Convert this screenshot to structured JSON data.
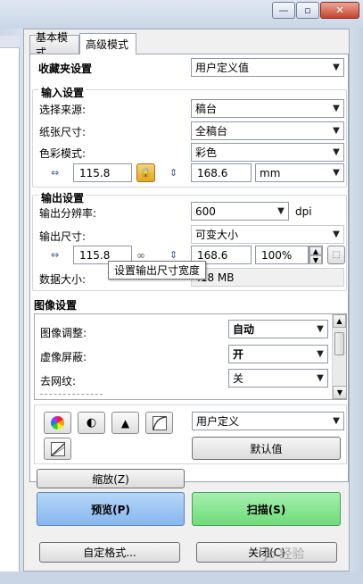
{
  "window": {
    "minimize_glyph": "—",
    "restore_glyph": "▫",
    "close_glyph": "✕"
  },
  "tabs": [
    "基本模式",
    "高级模式"
  ],
  "favorites": {
    "label": "收藏夹设置",
    "value": "用户定义值"
  },
  "input": {
    "heading": "输入设置",
    "source_label": "选择来源:",
    "source_value": "稿台",
    "paper_label": "纸张尺寸:",
    "paper_value": "全稿台",
    "color_label": "色彩模式:",
    "color_value": "彩色",
    "width": "115.8",
    "height": "168.6",
    "unit": "mm"
  },
  "output": {
    "heading": "输出设置",
    "resolution_label": "输出分辨率:",
    "resolution_value": "600",
    "resolution_unit": "dpi",
    "size_label": "输出尺寸:",
    "size_value": "可变大小",
    "width": "115.8",
    "height": "168.6",
    "scale": "100%",
    "datasize_label": "数据大小:",
    "datasize_value": ".18 MB",
    "tooltip": "设置输出尺寸宽度"
  },
  "image": {
    "heading": "图像设置",
    "rows": [
      {
        "label": "图像调整:",
        "value": "自动",
        "bold": true
      },
      {
        "label": "虚像屏蔽:",
        "value": "开",
        "bold": true
      },
      {
        "label": "去网纹:",
        "value": "关",
        "bold": false
      },
      {
        "label": "",
        "value": "",
        "bold": false
      }
    ]
  },
  "tools": {
    "preset_value": "用户定义",
    "default_button": "默认值"
  },
  "buttons": {
    "zoom": "缩放(Z)",
    "preview": "预览(P)",
    "scan": "扫描(S)",
    "custom_format": "自定格式...",
    "close": "关闭(C)"
  },
  "watermark": "Jb 经验",
  "colors": {
    "preview_fill": "#93c0f2",
    "scan_fill": "#7ee08a",
    "title_fill": "#d0dcea"
  }
}
